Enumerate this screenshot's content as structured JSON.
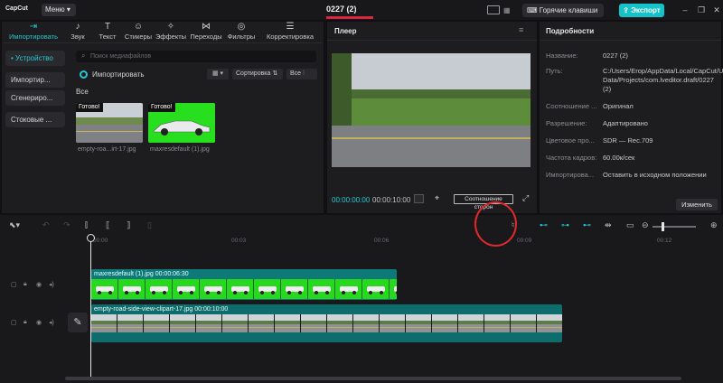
{
  "titlebar": {
    "app_name": "CapCut",
    "menu_label": "Меню",
    "project_title": "0227 (2)",
    "hotkeys_label": "Горячие клавиши",
    "export_label": "Экспорт",
    "accent_color": "#14c2c9"
  },
  "media_panel": {
    "categories": [
      {
        "icon": "import-icon",
        "glyph": "⇥",
        "label": "Импортировать"
      },
      {
        "icon": "audio-icon",
        "glyph": "♪",
        "label": "Звук"
      },
      {
        "icon": "text-icon",
        "glyph": "T",
        "label": "Текст"
      },
      {
        "icon": "sticker-icon",
        "glyph": "☺",
        "label": "Стикеры"
      },
      {
        "icon": "effects-icon",
        "glyph": "✧",
        "label": "Эффекты"
      },
      {
        "icon": "transitions-icon",
        "glyph": "⋈",
        "label": "Переходы"
      },
      {
        "icon": "filters-icon",
        "glyph": "◎",
        "label": "Фильтры"
      },
      {
        "icon": "adjust-icon",
        "glyph": "☰",
        "label": "Корректировка"
      }
    ],
    "sidebar": [
      "• Устройство",
      "Импортир...",
      "Сгенериро...",
      "Стоковые ..."
    ],
    "search_placeholder": "Поиск медиафайлов",
    "import_label": "Импортировать",
    "sort_label": "Сортировка",
    "filter_label": "Все",
    "section_label": "Все",
    "items": [
      {
        "badge": "Готово!",
        "name": "empty-roa...irt-17.jpg"
      },
      {
        "badge": "Готово!",
        "name": "maxresdefault (1).jpg"
      }
    ]
  },
  "player": {
    "title": "Плеер",
    "current_time": "00:00:00:00",
    "total_time": "00:00:10:00",
    "ratio_label": "Соотношение сторон"
  },
  "details": {
    "title": "Подробности",
    "rows": [
      {
        "label": "Название:",
        "value": "0227 (2)"
      },
      {
        "label": "Путь:",
        "value": "C:/Users/Erop/AppData/Local/CapCut/User Data/Projects/com.lveditor.draft/0227 (2)"
      },
      {
        "label": "Соотношение ...",
        "value": "Оригинал"
      },
      {
        "label": "Разрешение:",
        "value": "Адаптировано"
      },
      {
        "label": "Цветовое про...",
        "value": "SDR — Rec.709"
      },
      {
        "label": "Частота кадров:",
        "value": "60.00к/сек"
      },
      {
        "label": "Импортирова...",
        "value": "Оставить в исходном положении"
      }
    ],
    "change_label": "Изменить"
  },
  "timeline": {
    "ruler_ticks": [
      "00:00",
      "00:03",
      "00:06",
      "00:09",
      "00:12"
    ],
    "clips": [
      {
        "label": "maxresdefault (1).jpg  00:00:06:30"
      },
      {
        "label": "empty-road-side-view-clipart-17.jpg  00:00:10:00"
      }
    ]
  }
}
